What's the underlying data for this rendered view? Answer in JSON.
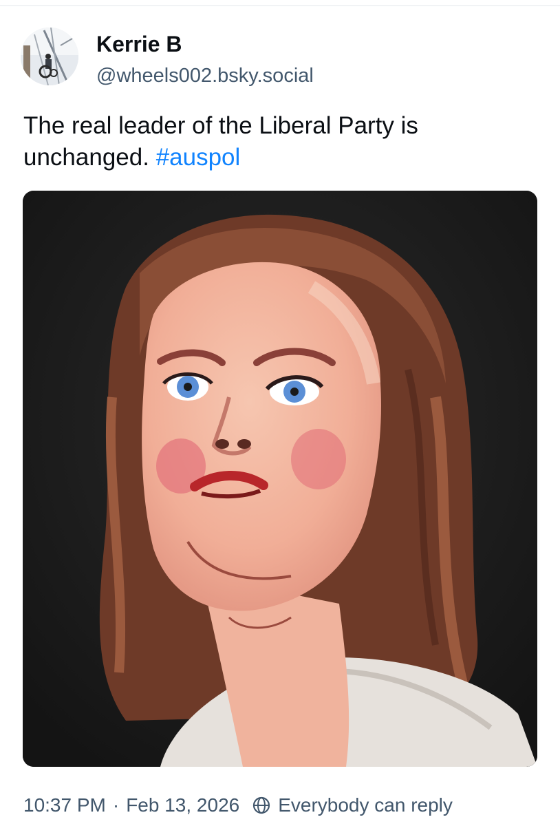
{
  "post": {
    "author": {
      "display_name": "Kerrie B",
      "handle": "@wheels002.bsky.social",
      "avatar_icon": "avatar-icon"
    },
    "text_main": "The real leader of the Liberal Party is unchanged.",
    "hashtag": "#auspol",
    "image": {
      "subject": "painted portrait",
      "colors": {
        "background": "#1b1b1b",
        "hair": "#7a4330",
        "skin": "#f2b7a0",
        "eyes": "#5b8fd6"
      }
    },
    "meta": {
      "time": "10:37 PM",
      "separator": "·",
      "date": "Feb 13, 2026",
      "reply_icon": "globe-icon",
      "reply_setting": "Everybody can reply"
    }
  },
  "colors": {
    "text": "#0b0f14",
    "secondary_text": "#42576c",
    "link": "#1083fe",
    "divider": "#e3e6ea"
  }
}
